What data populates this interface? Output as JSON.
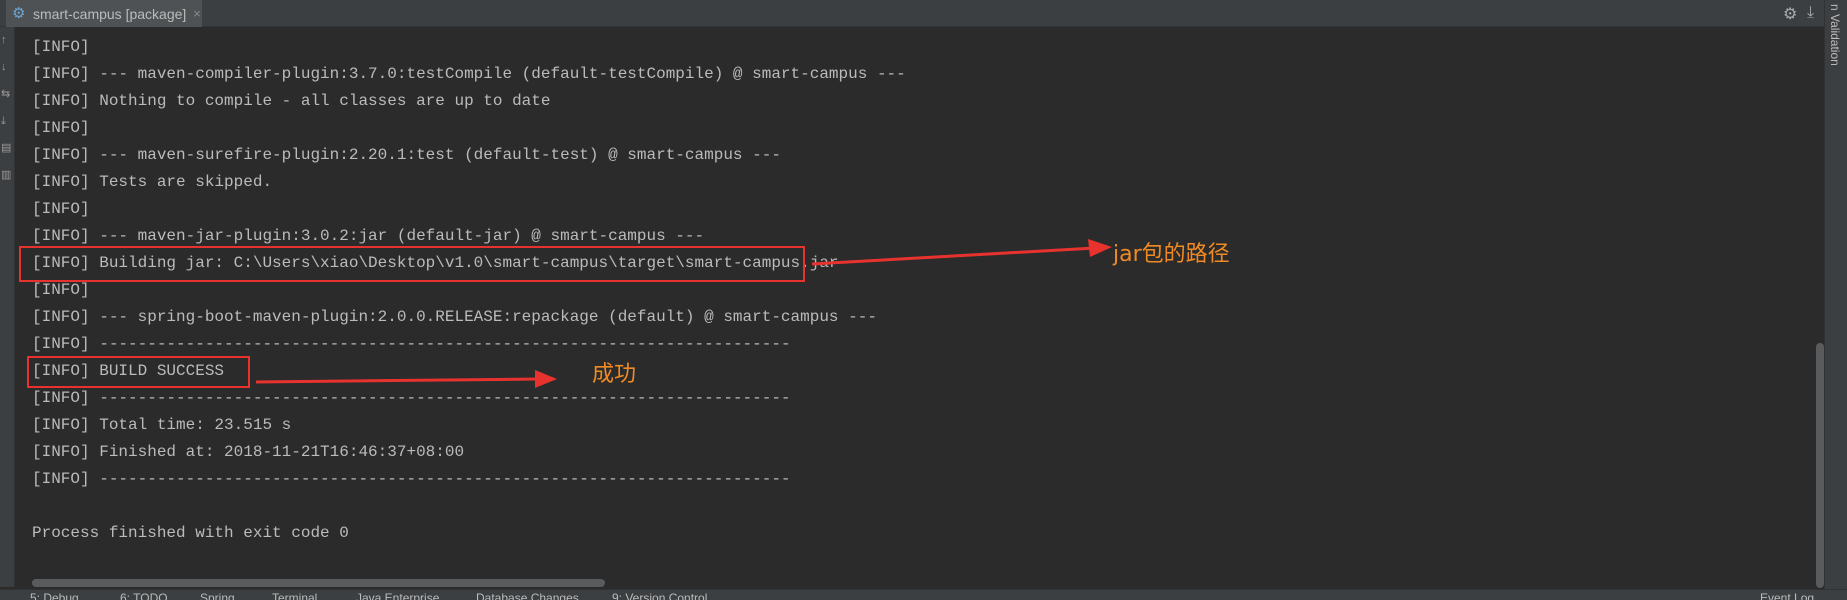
{
  "tab": {
    "title": "smart-campus [package]",
    "close": "×",
    "icon": "gear-icon"
  },
  "toolbar_right": {
    "settings_icon": "⚙",
    "minimize_icon": "⤓"
  },
  "right_strip": {
    "label": "n Validation"
  },
  "console_lines": [
    "[INFO]",
    "[INFO] --- maven-compiler-plugin:3.7.0:testCompile (default-testCompile) @ smart-campus ---",
    "[INFO] Nothing to compile - all classes are up to date",
    "[INFO]",
    "[INFO] --- maven-surefire-plugin:2.20.1:test (default-test) @ smart-campus ---",
    "[INFO] Tests are skipped.",
    "[INFO]",
    "[INFO] --- maven-jar-plugin:3.0.2:jar (default-jar) @ smart-campus ---",
    "[INFO] Building jar: C:\\Users\\xiao\\Desktop\\v1.0\\smart-campus\\target\\smart-campus.jar",
    "[INFO]",
    "[INFO] --- spring-boot-maven-plugin:2.0.0.RELEASE:repackage (default) @ smart-campus ---",
    "[INFO] ------------------------------------------------------------------------",
    "[INFO] BUILD SUCCESS",
    "[INFO] ------------------------------------------------------------------------",
    "[INFO] Total time: 23.515 s",
    "[INFO] Finished at: 2018-11-21T16:46:37+08:00",
    "[INFO] ------------------------------------------------------------------------",
    "",
    "Process finished with exit code 0"
  ],
  "annotations": {
    "jar_path": "jar包的路径",
    "success": "成功",
    "color": "#e8322e",
    "text_color": "#f08a24"
  },
  "statusbar": {
    "items": [
      "5: Debug",
      "6: TODO",
      "Spring",
      "Terminal",
      "Java Enterprise",
      "Database Changes",
      "9: Version Control",
      "Event Log"
    ]
  }
}
